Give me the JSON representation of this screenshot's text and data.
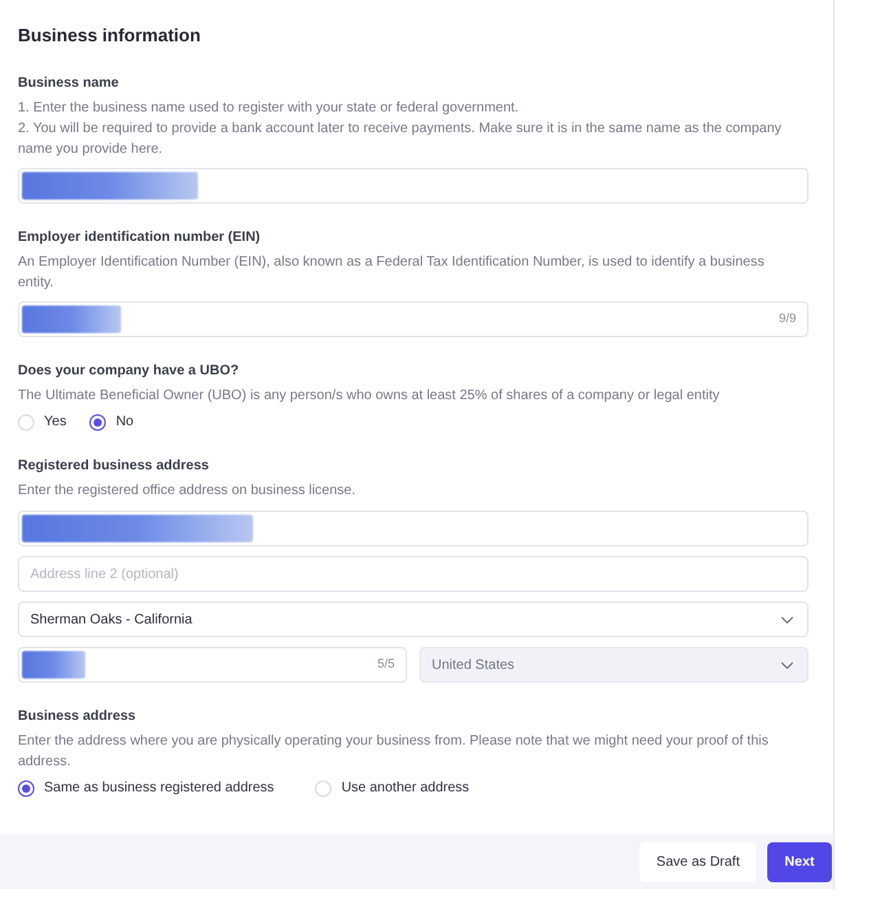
{
  "form": {
    "title": "Business information"
  },
  "sections": [
    {
      "label": "Business name",
      "hints": [
        "1. Enter the business name used to register with your state or federal government.",
        "2. You will be required to provide a bank account later to receive payments. Make sure it is in the same name as the company name you provide here."
      ],
      "rows": [
        [
          {
            "kind": "text",
            "redacted": true,
            "disabled": false
          }
        ]
      ]
    },
    {
      "label": "Employer identification number (EIN)",
      "hints": [
        "An Employer Identification Number (EIN), also known as a Federal Tax Identification Number, is used to identify a business entity."
      ],
      "rows": [
        [
          {
            "kind": "text",
            "redacted": true,
            "counter": "9/9",
            "disabled": false
          }
        ]
      ]
    },
    {
      "label": "Does your company have a UBO?",
      "hints": [
        "The Ultimate Beneficial Owner (UBO) is any person/s who owns at least 25% of shares of a company or legal entity"
      ],
      "options": [
        {
          "label": "Yes",
          "selected": false
        },
        {
          "label": "No",
          "selected": true
        }
      ]
    },
    {
      "label": "Registered business address",
      "hints": [
        "Enter the registered office address on business license."
      ],
      "rows": [
        [
          {
            "kind": "text",
            "redacted": true,
            "disabled": false
          }
        ],
        [
          {
            "kind": "text",
            "redacted": false,
            "placeholder": "Address line 2 (optional)",
            "disabled": false
          }
        ],
        [
          {
            "kind": "select",
            "redacted": false,
            "value": "Sherman Oaks - California",
            "disabled": false
          }
        ],
        [
          {
            "kind": "text",
            "redacted": true,
            "counter": "5/5",
            "disabled": false
          },
          {
            "kind": "select",
            "redacted": false,
            "value": "United States",
            "disabled": true
          }
        ]
      ]
    },
    {
      "label": "Business address",
      "hints": [
        "Enter the address where you are physically operating your business from. Please note that we might need your proof of this address."
      ],
      "options": [
        {
          "label": "Same as business registered address",
          "selected": true
        },
        {
          "label": "Use another address",
          "selected": false
        }
      ]
    }
  ],
  "footer": {
    "buttons": [
      {
        "label": "Save as Draft",
        "kind": "secondary"
      },
      {
        "label": "Next",
        "kind": "primary"
      }
    ]
  }
}
